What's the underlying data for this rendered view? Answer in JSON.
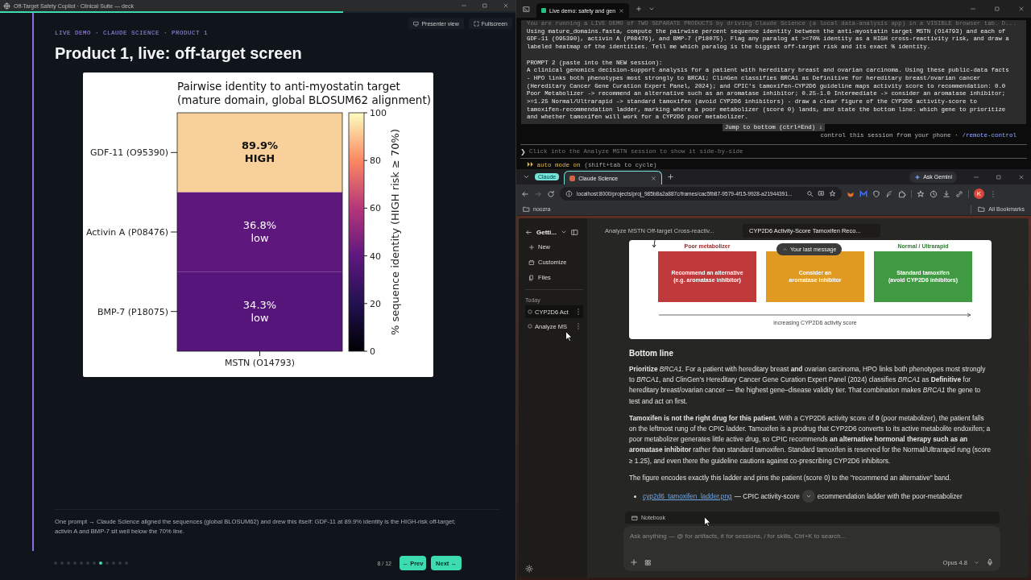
{
  "deck": {
    "window_title": "Off-Target Safety Copilot · Clinical Suite — deck",
    "progress": {
      "level": 0.665
    },
    "toolbar_buttons": [
      {
        "kind": "presenter",
        "label": "Presenter view"
      },
      {
        "kind": "fullscreen",
        "label": "Fullscreen"
      }
    ],
    "kicker": "LIVE DEMO · CLAUDE SCIENCE · PRODUCT 1",
    "title": "Product 1, live: off-target screen",
    "heatmap": {
      "title_lines": [
        "Pairwise identity to anti-myostatin target",
        "(mature domain, global BLOSUM62 alignment)"
      ],
      "rows": [
        {
          "label": "GDF-11 (O95390)",
          "value": "89.9%",
          "risk": "HIGH",
          "flagged": true,
          "color": "#f8d09a"
        },
        {
          "label": "Activin A (P08476)",
          "value": "36.8%",
          "risk": "low",
          "flagged": false,
          "color": "#5e177c"
        },
        {
          "label": "BMP-7 (P18075)",
          "value": "34.3%",
          "risk": "low",
          "flagged": false,
          "color": "#55157a"
        }
      ],
      "column_label": "MSTN (O14793)",
      "colorbar_ticks": [
        "100",
        "80",
        "60",
        "40",
        "20",
        "0"
      ],
      "colorbar_label": "% sequence identity  (HIGH risk ≥ 70%)"
    },
    "caption": "One prompt → Claude Science aligned the sequences (global BLOSUM62) and drew this itself: GDF-11 at 89.9% identity is the HIGH-risk off-target; activin A and BMP-7 sit well below the 70% line.",
    "dots": [
      {
        "selected": false
      },
      {
        "selected": false
      },
      {
        "selected": false
      },
      {
        "selected": false
      },
      {
        "selected": false
      },
      {
        "selected": false
      },
      {
        "selected": false
      },
      {
        "selected": true
      },
      {
        "selected": false
      },
      {
        "selected": false
      },
      {
        "selected": false
      },
      {
        "selected": false
      }
    ],
    "page_indicator": "8 / 12",
    "nav_buttons": [
      {
        "kind": "prev",
        "label": "← Prev"
      },
      {
        "kind": "next",
        "label": "Next →"
      }
    ]
  },
  "terminal": {
    "tab_title": "Live demo: safety and gen",
    "faded_line": "You are running a LIVE DEMO of TWO SEPARATE PRODUCTS by driving Claude Science (a local data-analysis app) in a VISIBLE browser tab. D...",
    "paragraphs": [
      [
        "Using mature_domains.fasta, compute the pairwise percent sequence identity between the anti-myostatin target MSTN (O14793) and each of",
        "GDF-11 (O95390), activin A (P08476), and BMP-7 (P18075). Flag any paralog at >=70% identity as a HIGH cross-reactivity risk, and draw a",
        "labeled heatmap of the identities. Tell me which paralog is the biggest off-target risk and its exact % identity."
      ],
      [
        "PROMPT 2 (paste into the NEW session):",
        "A clinical genomics decision-support analysis for a patient with hereditary breast and ovarian carcinoma. Using these public-data facts",
        "- HPO links both phenotypes most strongly to BRCA1; ClinGen classifies BRCA1 as Definitive for hereditary breast/ovarian cancer",
        "(Hereditary Cancer Gene Curation Expert Panel, 2024); and CPIC's tamoxifen-CYP2D6 guideline maps activity score to recommendation: 0.0",
        "Poor Metabolizer -> recommend an alternative such as an aromatase inhibitor; 0.25-1.0 Intermediate -> consider an aromatase inhibitor;",
        ">=1.25 Normal/Ultrarapid -> standard tamoxifen (avoid CYP2D6 inhibitors) - draw a clear figure of the CYP2D6 activity-score to",
        "tamoxifen-recommendation ladder, marking where a poor metabolizer (score 0) lands, and state the bottom line: which gene to prioritize",
        "and whether tamoxifen will work for a CYP2D6 poor metabolizer."
      ]
    ],
    "jump_button": "Jump to bottom (ctrl+End) ↓",
    "remote_hint": "control this session from your phone ·",
    "remote_link": "/remote-control",
    "prompt_symbol": "❯",
    "prompt_placeholder": "Click into the Analyze MSTN session to show it side-by-side",
    "mode_label": "⏵⏵ auto mode on",
    "mode_hint": "(shift+tab to cycle)"
  },
  "browser": {
    "group_chip": "Claude",
    "tabs": [
      {
        "title": "Claude Science",
        "selected": true
      }
    ],
    "gemini_button": "Ask Gemini",
    "url": "localhost:8000/projects/proj_985b8a2a887c/frames/cac5fb87-9579-4f15-9928-a21944391...",
    "profile_initial": "K",
    "bookmarks": [
      "noozra"
    ],
    "all_bookmarks": "All Bookmarks"
  },
  "app": {
    "sidebar": {
      "project": "Getti...",
      "actions": [
        {
          "kind": "new",
          "label": "New"
        },
        {
          "kind": "customize",
          "label": "Customize"
        },
        {
          "kind": "files",
          "label": "Files"
        }
      ],
      "section": "Today",
      "sessions": [
        {
          "title": "CYP2D6 Act",
          "selected": true
        },
        {
          "title": "Analyze MS",
          "selected": false
        }
      ]
    },
    "tabs": [
      {
        "title": "Analyze MSTN Off-target Cross-reactiv...",
        "selected": false
      },
      {
        "title": "CYP2D6 Activity-Score Tamoxifen Reco...",
        "selected": true
      }
    ],
    "figure": {
      "bands": [
        {
          "heading": "Poor metabolizer",
          "lines": [
            "Recommend an alternative",
            "(e.g. aromatase inhibitor)"
          ],
          "color": "#c0393b"
        },
        {
          "lines": [
            "Consider an",
            "aromatase inhibitor"
          ],
          "color": "#e09a22"
        },
        {
          "heading": "Normal / Ultrarapid",
          "lines": [
            "Standard tamoxifen",
            "(avoid CYP2D6 inhibitors)"
          ],
          "color": "#409a42"
        }
      ],
      "axis_label": "increasing CYP2D6 activity score"
    },
    "last_message_button": "Your last message",
    "heading": "Bottom line",
    "paragraphs": [
      "**Prioritize** *BRCA1*. For a patient with hereditary breast **and** ovarian carcinoma, HPO links both phenotypes most strongly to *BRCA1*, and ClinGen's Hereditary Cancer Gene Curation Expert Panel (2024) classifies *BRCA1* as **Definitive** for hereditary breast/ovarian cancer — the highest gene–disease validity tier. That combination makes *BRCA1* the gene to test and act on first.",
      "**Tamoxifen is not the right drug for this patient.** With a CYP2D6 activity score of **0** (poor metabolizer), the patient falls on the leftmost rung of the CPIC ladder. Tamoxifen is a prodrug that CYP2D6 converts to its active metabolite endoxifen; a poor metabolizer generates little active drug, so CPIC recommends **an alternative hormonal therapy such as an aromatase inhibitor** rather than standard tamoxifen. Standard tamoxifen is reserved for the Normal/Ultrarapid rung (score ≥ 1.25), and even there the guideline cautions against co-prescribing CYP2D6 inhibitors.",
      "The figure encodes exactly this ladder and pins the patient (score 0) to the \"recommend an alternative\" band."
    ],
    "attachment": {
      "link": "cyp2d6_tamoxifen_ladder.png",
      "text_before": "— CPIC activity-score",
      "text_after": "ecommendation ladder with the poor-metabolizer"
    },
    "notebook_label": "Notebook",
    "composer": {
      "placeholder": "Ask anything — @ for artifacts, # for sessions, / for skills, Ctrl+K to search...",
      "model": "Opus 4.8"
    }
  }
}
